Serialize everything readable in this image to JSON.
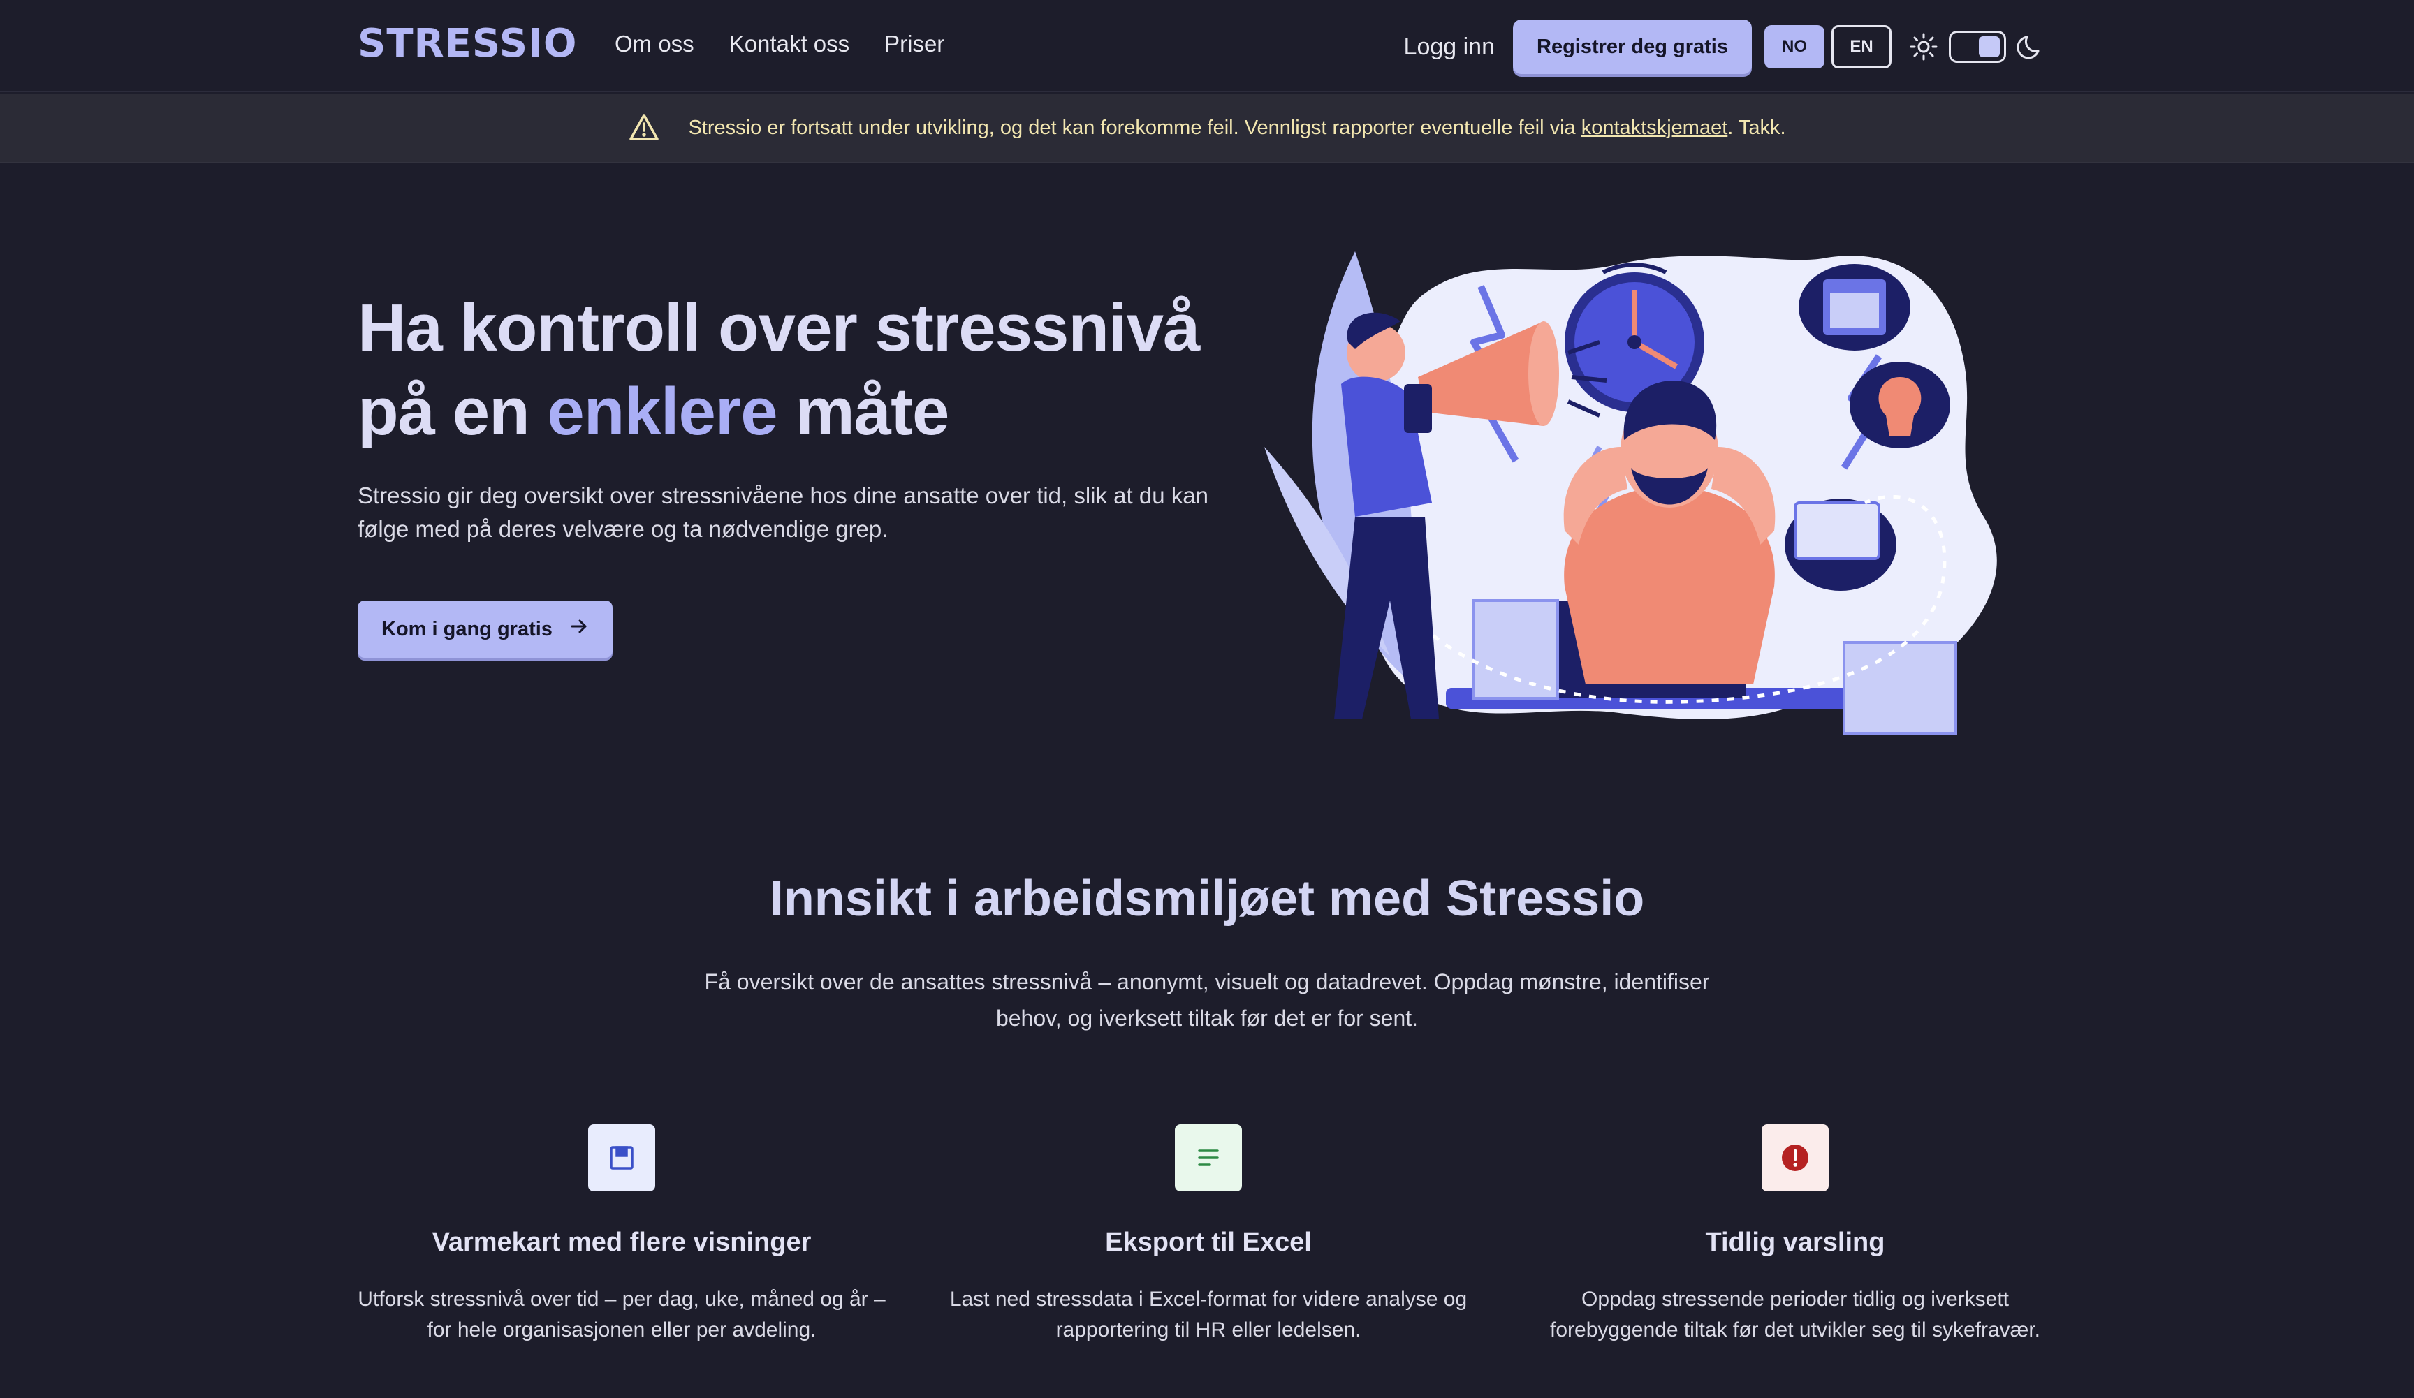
{
  "nav": {
    "logo": "STRESSIO",
    "links": [
      "Om oss",
      "Kontakt oss",
      "Priser"
    ],
    "login": "Logg inn",
    "register": "Registrer deg gratis",
    "lang_no": "NO",
    "lang_en": "EN"
  },
  "banner": {
    "text_before": "Stressio er fortsatt under utvikling, og det kan forekomme feil. Vennligst rapporter eventuelle feil via ",
    "link": "kontaktskjemaet",
    "text_after": ". Takk."
  },
  "hero": {
    "title_line1": "Ha kontroll over stressnivå",
    "title_pre": "på en ",
    "title_accent": "enklere",
    "title_post": " måte",
    "text": "Stressio gir deg oversikt over stressnivåene hos dine ansatte over tid, slik at du kan følge med på deres velvære og ta nødvendige grep.",
    "cta": "Kom i gang gratis"
  },
  "insight": {
    "title": "Innsikt i arbeidsmiljøet med Stressio",
    "text": "Få oversikt over de ansattes stressnivå – anonymt, visuelt og datadrevet. Oppdag mønstre, identifiser behov, og iverksett tiltak før det er for sent."
  },
  "features": [
    {
      "title": "Varmekart med flere visninger",
      "text": "Utforsk stressnivå over tid – per dag, uke, måned og år – for hele organisasjonen eller per avdeling.",
      "icon": "calendar-icon",
      "bg": "#e8ecfd",
      "fg": "#3a50c8"
    },
    {
      "title": "Eksport til Excel",
      "text": "Last ned stressdata i Excel-format for videre analyse og rapportering til HR eller ledelsen.",
      "icon": "document-lines-icon",
      "bg": "#e9f8ec",
      "fg": "#2e8a45"
    },
    {
      "title": "Tidlig varsling",
      "text": "Oppdag stressende perioder tidlig og iverksett forebyggende tiltak før det utvikler seg til sykefravær.",
      "icon": "alert-icon",
      "bg": "#fbeceb",
      "fg": "#b52222"
    }
  ],
  "colors": {
    "accent": "#b3b8f5",
    "background": "#1d1d2b",
    "banner_text": "#f2e6b0"
  }
}
